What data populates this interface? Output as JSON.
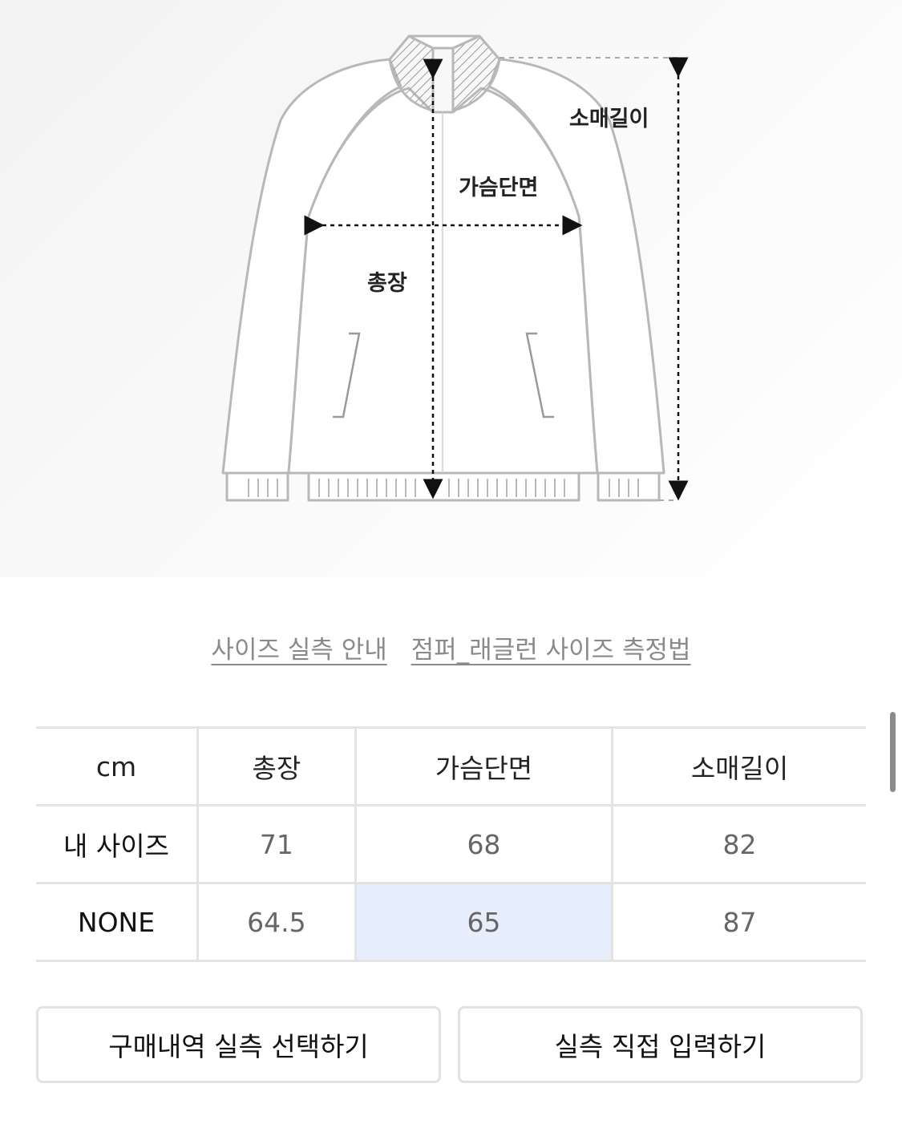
{
  "diagram": {
    "labels": {
      "sleeve": "소매길이",
      "chest": "가슴단면",
      "length": "총장"
    }
  },
  "links": {
    "size_guide": "사이즈 실측 안내",
    "measure_method": "점퍼_래글런 사이즈 측정법"
  },
  "table": {
    "headers": [
      "cm",
      "총장",
      "가슴단면",
      "소매길이"
    ],
    "rows": [
      {
        "label": "내 사이즈",
        "values": [
          "71",
          "68",
          "82"
        ]
      },
      {
        "label": "NONE",
        "values": [
          "64.5",
          "65",
          "87"
        ]
      }
    ]
  },
  "buttons": {
    "select_history": "구매내역 실측 선택하기",
    "direct_input": "실측 직접 입력하기"
  },
  "colors": {
    "highlight": "#e6edfb",
    "border": "#e3e3e3"
  }
}
